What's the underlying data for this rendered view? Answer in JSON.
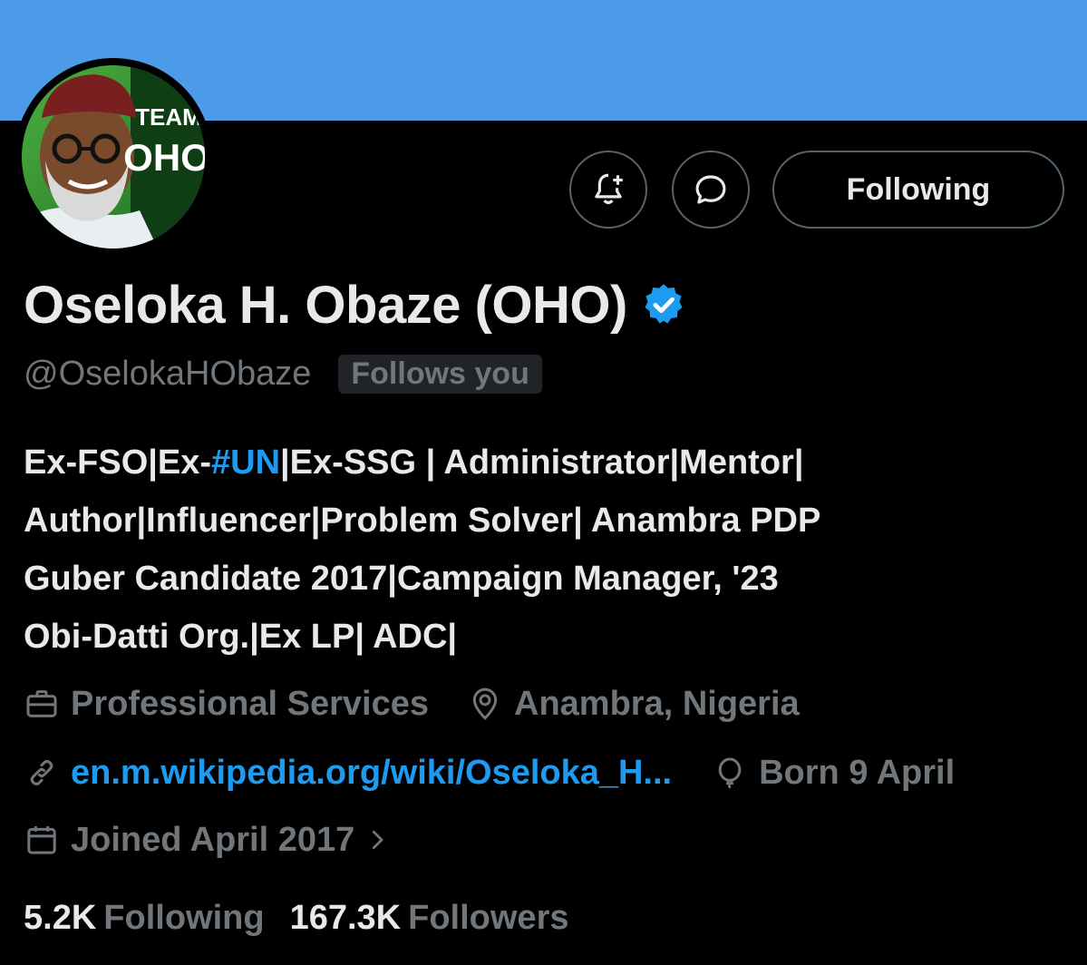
{
  "profile": {
    "display_name": "Oseloka H. Obaze (OHO)",
    "handle": "@OselokaHObaze",
    "follows_you_badge": "Follows you",
    "avatar_text_top": "TEAM",
    "avatar_text_bottom": "OHO",
    "verified_icon": "verified-badge-icon"
  },
  "actions": {
    "notify_icon": "bell-plus-icon",
    "message_icon": "message-bubble-icon",
    "following_label": "Following"
  },
  "bio": {
    "line1_pre": "Ex-FSO|Ex-",
    "line1_hashtag": "#UN",
    "line1_post": "|Ex-SSG | Administrator|Mentor|",
    "line2": "Author|Influencer|Problem Solver| Anambra PDP",
    "line3": "Guber Candidate 2017|Campaign Manager, '23",
    "line4": "Obi-Datti Org.|Ex LP| ADC|"
  },
  "meta": {
    "category": "Professional Services",
    "location": "Anambra, Nigeria",
    "website": "en.m.wikipedia.org/wiki/Oseloka_H...",
    "birthday": "Born 9 April",
    "joined": "Joined April 2017"
  },
  "stats": {
    "following_count": "5.2K",
    "following_label": "Following",
    "followers_count": "167.3K",
    "followers_label": "Followers"
  },
  "colors": {
    "banner": "#4d9be8",
    "background": "#000000",
    "primary_text": "#e7e9ea",
    "secondary_text": "#71767b",
    "accent": "#1d9bf0",
    "border": "#536471"
  }
}
